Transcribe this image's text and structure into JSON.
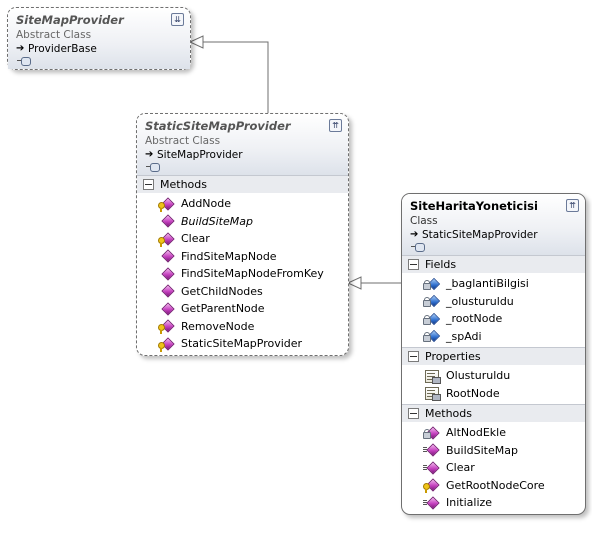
{
  "diagram": {
    "classes": [
      {
        "id": "sitemapprovider",
        "name": "SiteMapProvider",
        "kind": "Abstract Class",
        "abstract": true,
        "base": "ProviderBase",
        "collapsed": true,
        "toggle_glyph": "⇊",
        "sections": []
      },
      {
        "id": "staticsitemapprovider",
        "name": "StaticSiteMapProvider",
        "kind": "Abstract Class",
        "abstract": true,
        "base": "SiteMapProvider",
        "collapsed": false,
        "toggle_glyph": "⇈",
        "sections": [
          {
            "title": "Methods",
            "members": [
              {
                "name": "AddNode",
                "icon": "method-protected-icon",
                "italic": false
              },
              {
                "name": "BuildSiteMap",
                "icon": "method-public-icon",
                "italic": true
              },
              {
                "name": "Clear",
                "icon": "method-protected-icon",
                "italic": false
              },
              {
                "name": "FindSiteMapNode",
                "icon": "method-public-icon",
                "italic": false
              },
              {
                "name": "FindSiteMapNodeFromKey",
                "icon": "method-public-icon",
                "italic": false
              },
              {
                "name": "GetChildNodes",
                "icon": "method-public-icon",
                "italic": false
              },
              {
                "name": "GetParentNode",
                "icon": "method-public-icon",
                "italic": false
              },
              {
                "name": "RemoveNode",
                "icon": "method-protected-icon",
                "italic": false
              },
              {
                "name": "StaticSiteMapProvider",
                "icon": "method-protected-icon",
                "italic": false
              }
            ]
          }
        ]
      },
      {
        "id": "siteharitayoneticisi",
        "name": "SiteHaritaYoneticisi",
        "kind": "Class",
        "abstract": false,
        "base": "StaticSiteMapProvider",
        "collapsed": false,
        "toggle_glyph": "⇈",
        "sections": [
          {
            "title": "Fields",
            "members": [
              {
                "name": "_baglantiBilgisi",
                "icon": "field-private-icon",
                "italic": false
              },
              {
                "name": "_olusturuldu",
                "icon": "field-private-icon",
                "italic": false
              },
              {
                "name": "_rootNode",
                "icon": "field-private-icon",
                "italic": false
              },
              {
                "name": "_spAdi",
                "icon": "field-private-icon",
                "italic": false
              }
            ]
          },
          {
            "title": "Properties",
            "members": [
              {
                "name": "Olusturuldu",
                "icon": "property-icon",
                "italic": false
              },
              {
                "name": "RootNode",
                "icon": "property-icon",
                "italic": false
              }
            ]
          },
          {
            "title": "Methods",
            "members": [
              {
                "name": "AltNodEkle",
                "icon": "method-private-icon",
                "italic": false
              },
              {
                "name": "BuildSiteMap",
                "icon": "method-override-icon",
                "italic": false
              },
              {
                "name": "Clear",
                "icon": "method-override-icon",
                "italic": false
              },
              {
                "name": "GetRootNodeCore",
                "icon": "method-protected-icon",
                "italic": false
              },
              {
                "name": "Initialize",
                "icon": "method-override-icon",
                "italic": false
              }
            ]
          }
        ]
      }
    ],
    "inheritance": [
      {
        "from": "staticsitemapprovider",
        "to": "sitemapprovider"
      },
      {
        "from": "siteharitayoneticisi",
        "to": "staticsitemapprovider"
      }
    ]
  }
}
